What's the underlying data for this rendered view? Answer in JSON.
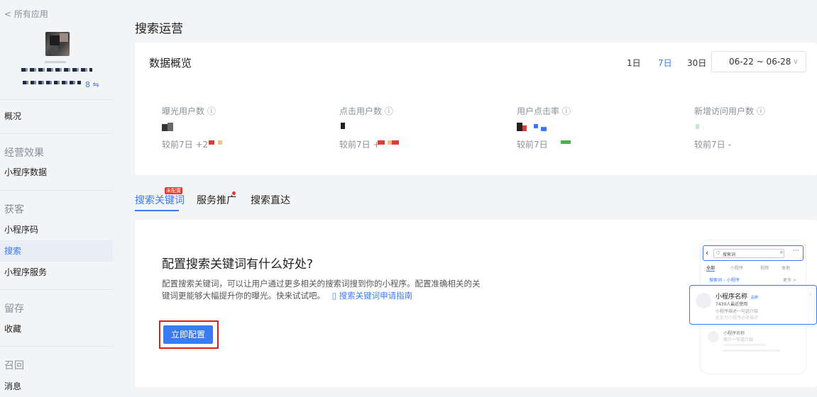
{
  "sidebar": {
    "back_label": "< 所有应用",
    "refresh_text": "8 ⇋",
    "items": {
      "overview": "概况",
      "group_ops": "经营效果",
      "mini_data": "小程序数据",
      "group_acquire": "获客",
      "mini_code": "小程序码",
      "search": "搜索",
      "mini_service": "小程序服务",
      "group_retain": "留存",
      "favorite": "收藏",
      "group_recall": "召回",
      "message": "消息"
    }
  },
  "page": {
    "title": "搜索运营"
  },
  "overview": {
    "title": "数据概览",
    "ranges": [
      "1日",
      "7日",
      "30日"
    ],
    "active_range": "7日",
    "date_range": "06-22 ~ 06-28",
    "stats": [
      {
        "label": "曝光用户数 ⓘ",
        "compare": "较前7日 +2"
      },
      {
        "label": "点击用户数 ⓘ",
        "compare": "较前7日 +"
      },
      {
        "label": "用户点击率 ⓘ",
        "compare": "较前7日"
      },
      {
        "label": "新增访问用户数 ⓘ",
        "compare": "较前7日 -"
      }
    ]
  },
  "tabs": {
    "items": [
      "搜索关键词",
      "服务推广",
      "搜索直达"
    ],
    "active": "搜索关键词",
    "badge": "未配置"
  },
  "main": {
    "heading": "配置搜索关键词有什么好处?",
    "description": "配置搜索关键词，可以让用户通过更多相关的搜索词搜到你的小程序。配置准确相关的关键词更能够大幅提升你的曝光。快来试试吧。",
    "guide_link": "搜索关键词申请指南",
    "cta_label": "立即配置"
  },
  "preview": {
    "search_placeholder": "搜索词",
    "filters": [
      "全部",
      "小程序",
      "视频",
      "本地"
    ],
    "result_header": "搜索词 – 小程序",
    "more": "更多 >",
    "card_title": "小程序名称",
    "card_tag": "品牌",
    "card_users": "7430人最近使用",
    "card_desc": "小程序描述一句话介绍",
    "card_sub": "此处为小程序必体描述",
    "row2_title": "小程序名称",
    "row2_desc": "简介一句话介绍"
  },
  "colors": {
    "accent": "#3a7bf0",
    "alert": "#e53935",
    "highlight_box": "#e01b1b"
  }
}
